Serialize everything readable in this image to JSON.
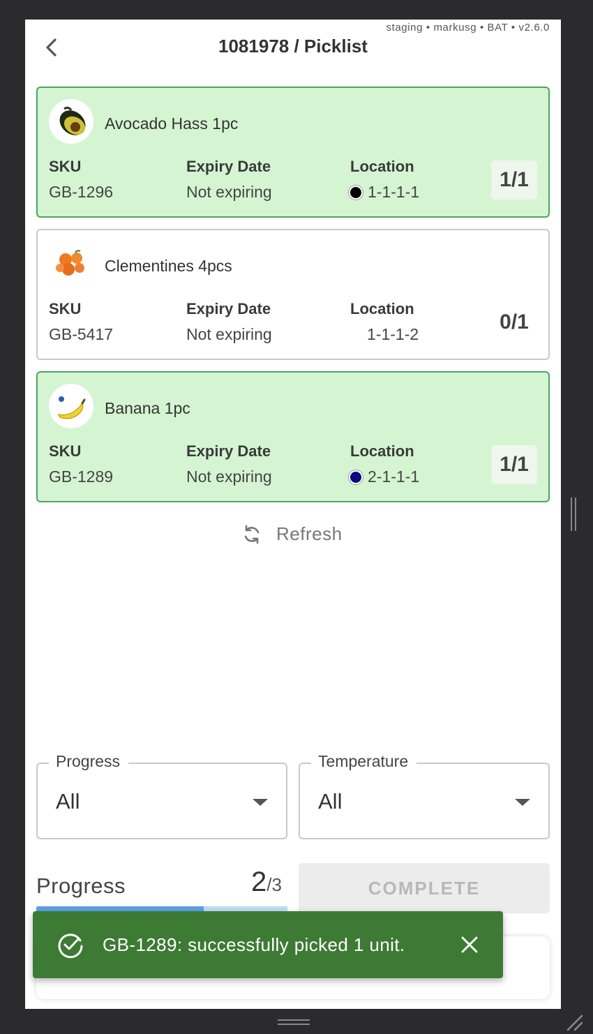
{
  "env_label": "staging • markusg • BAT • v2.6.0",
  "header": {
    "title": "1081978 / Picklist"
  },
  "columns": {
    "sku": "SKU",
    "expiry": "Expiry Date",
    "location": "Location"
  },
  "items": [
    {
      "name": "Avocado Hass 1pc",
      "sku": "GB-1296",
      "expiry": "Not expiring",
      "location": "1-1-1-1",
      "location_color": "#000000",
      "count": "1/1",
      "picked": 1,
      "required": 1
    },
    {
      "name": "Clementines 4pcs",
      "sku": "GB-5417",
      "expiry": "Not expiring",
      "location": "1-1-1-2",
      "location_color": "",
      "count": "0/1",
      "picked": 0,
      "required": 1
    },
    {
      "name": "Banana 1pc",
      "sku": "GB-1289",
      "expiry": "Not expiring",
      "location": "2-1-1-1",
      "location_color": "#0a0a80",
      "count": "1/1",
      "picked": 1,
      "required": 1
    }
  ],
  "refresh_label": "Refresh",
  "filters": {
    "progress": {
      "label": "Progress",
      "value": "All"
    },
    "temperature": {
      "label": "Temperature",
      "value": "All"
    }
  },
  "progress": {
    "label": "Progress",
    "done": "2",
    "total": "/3",
    "fraction": 0.6667
  },
  "complete_label": "COMPLETE",
  "toast": {
    "message": "GB-1289: successfully picked 1 unit."
  },
  "colors": {
    "done_bg": "#d5f5d2",
    "done_border": "#4fa45f",
    "toast_bg": "#3d7a34",
    "progress_fill": "#5aa2e4"
  }
}
